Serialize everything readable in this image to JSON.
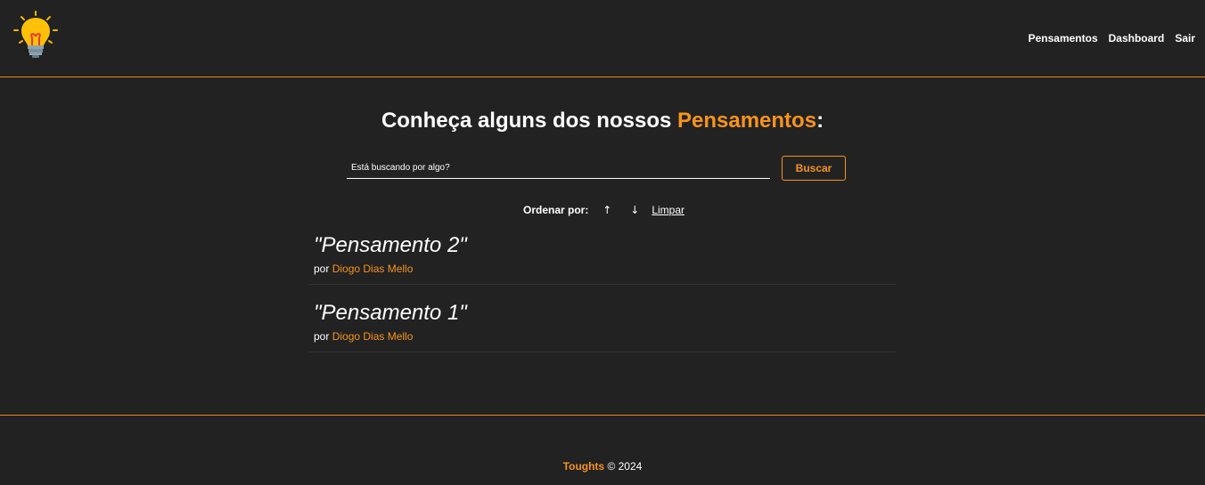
{
  "navbar": {
    "logo_icon": "lightbulb-icon",
    "links": [
      {
        "label": "Pensamentos"
      },
      {
        "label": "Dashboard"
      },
      {
        "label": "Sair"
      }
    ]
  },
  "main": {
    "heading_prefix": "Conheça alguns dos nossos ",
    "heading_accent": "Pensamentos",
    "heading_suffix": ":",
    "search": {
      "placeholder": "Está buscando por algo?",
      "value": "",
      "button_label": "Buscar"
    },
    "order": {
      "label": "Ordenar por:",
      "up_icon": "arrow-up-icon",
      "up_label": "↑",
      "down_icon": "arrow-down-icon",
      "down_label": "↓",
      "clear_label": "Limpar"
    },
    "thoughts": [
      {
        "title": "\"Pensamento 2\"",
        "by": "por ",
        "author": "Diogo Dias Mello"
      },
      {
        "title": "\"Pensamento 1\"",
        "by": "por ",
        "author": "Diogo Dias Mello"
      }
    ]
  },
  "footer": {
    "brand": "Toughts",
    "copyright": " © 2024"
  },
  "colors": {
    "background": "#222222",
    "accent": "#f7931e",
    "text": "#ffffff"
  }
}
